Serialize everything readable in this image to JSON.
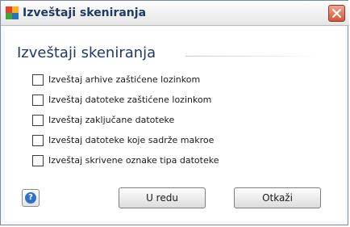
{
  "window": {
    "title": "Izveštaji skeniranja",
    "icon": "avg-app-icon",
    "close_icon": "close-icon"
  },
  "dialog": {
    "heading": "Izveštaji skeniranja",
    "options": [
      {
        "label": "Izveštaj arhive zaštićene lozinkom",
        "checked": false
      },
      {
        "label": "Izveštaj datoteke zaštićene lozinkom",
        "checked": false
      },
      {
        "label": "Izveštaj zaključane datoteke",
        "checked": false
      },
      {
        "label": "Izveštaj datoteke koje sadrže makroe",
        "checked": false
      },
      {
        "label": "Izveštaj skrivene oznake tipa datoteke",
        "checked": false
      }
    ]
  },
  "buttons": {
    "help_icon": "help-icon",
    "help_glyph": "?",
    "ok_label": "U redu",
    "cancel_label": "Otkaži"
  },
  "colors": {
    "title_text": "#1f3a68",
    "close_button": "#d8553a",
    "help_icon": "#2e73c7"
  }
}
